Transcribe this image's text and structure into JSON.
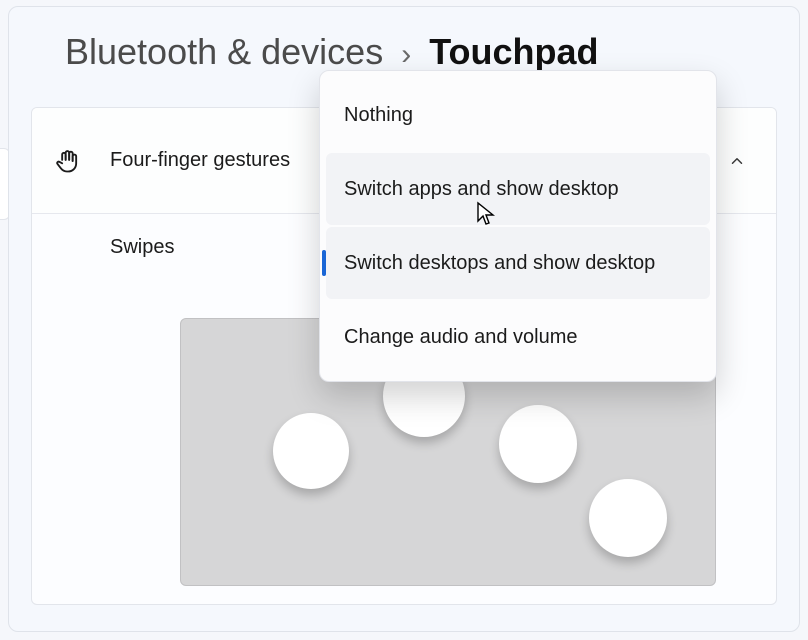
{
  "breadcrumb": {
    "parent": "Bluetooth & devices",
    "current": "Touchpad"
  },
  "section": {
    "title": "Four-finger gestures",
    "swipes_label": "Swipes"
  },
  "dropdown": {
    "options": [
      "Nothing",
      "Switch apps and show desktop",
      "Switch desktops and show desktop",
      "Change audio and volume"
    ],
    "hovered_index": 1,
    "selected_index": 2
  }
}
